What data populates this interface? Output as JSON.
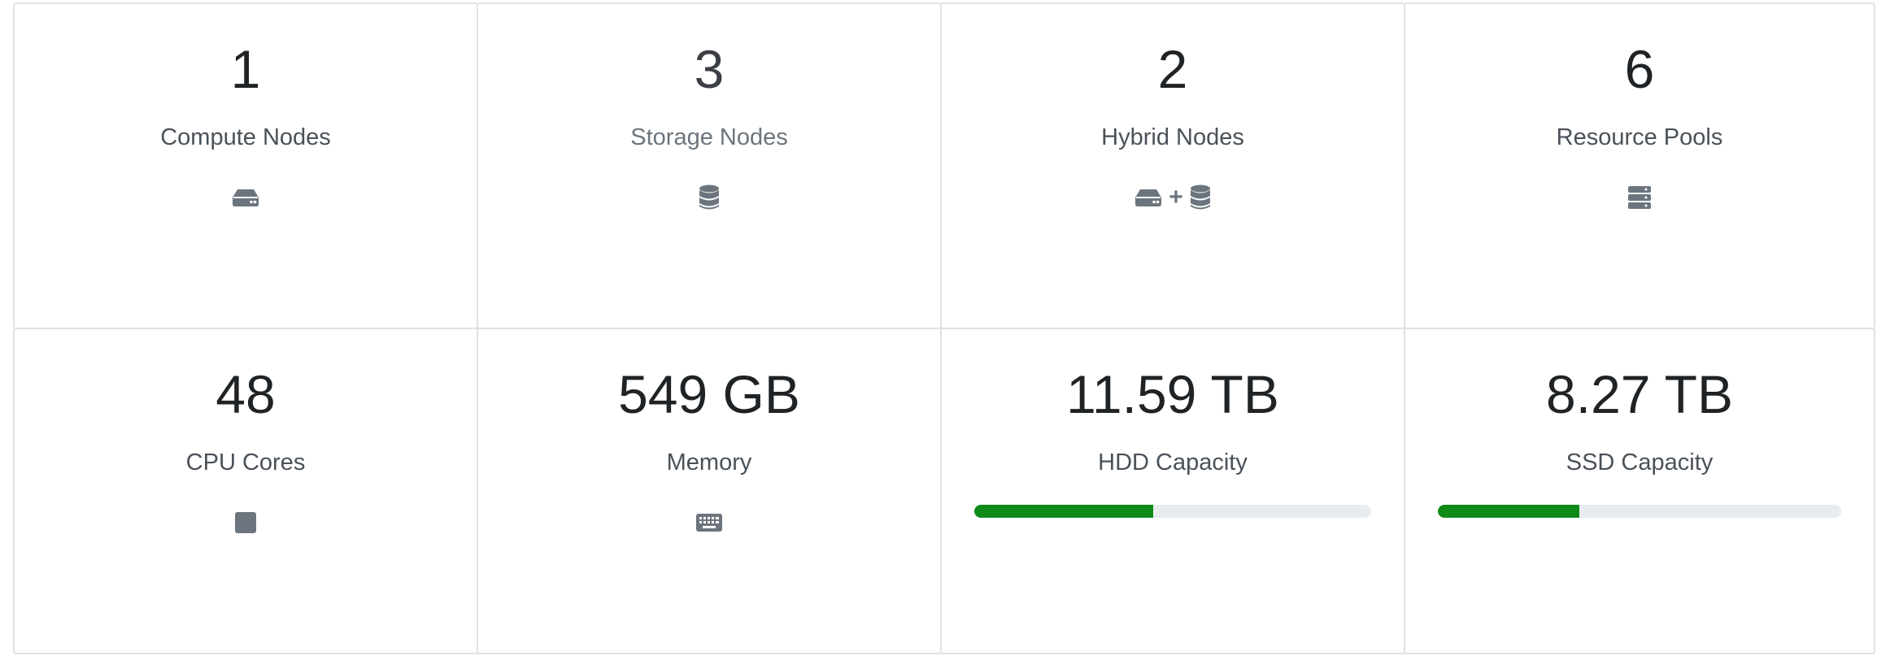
{
  "cards": [
    {
      "value": "1",
      "label": "Compute Nodes",
      "icon": "hdd-icon"
    },
    {
      "value": "3",
      "label": "Storage Nodes",
      "icon": "database-icon"
    },
    {
      "value": "2",
      "label": "Hybrid Nodes",
      "icon": "hdd-plus-database-icon",
      "separator": "+"
    },
    {
      "value": "6",
      "label": "Resource Pools",
      "icon": "server-icon"
    },
    {
      "value": "48",
      "label": "CPU Cores",
      "icon": "square-icon"
    },
    {
      "value": "549 GB",
      "label": "Memory",
      "icon": "keyboard-icon"
    },
    {
      "value": "11.59 TB",
      "label": "HDD Capacity",
      "progress_fraction": 0.45
    },
    {
      "value": "8.27 TB",
      "label": "SSD Capacity",
      "progress_fraction": 0.35
    }
  ],
  "colors": {
    "icon": "#6c757d",
    "progress_fill": "#0e8a16",
    "progress_track": "#e9ecef",
    "border": "#dee2e6"
  }
}
